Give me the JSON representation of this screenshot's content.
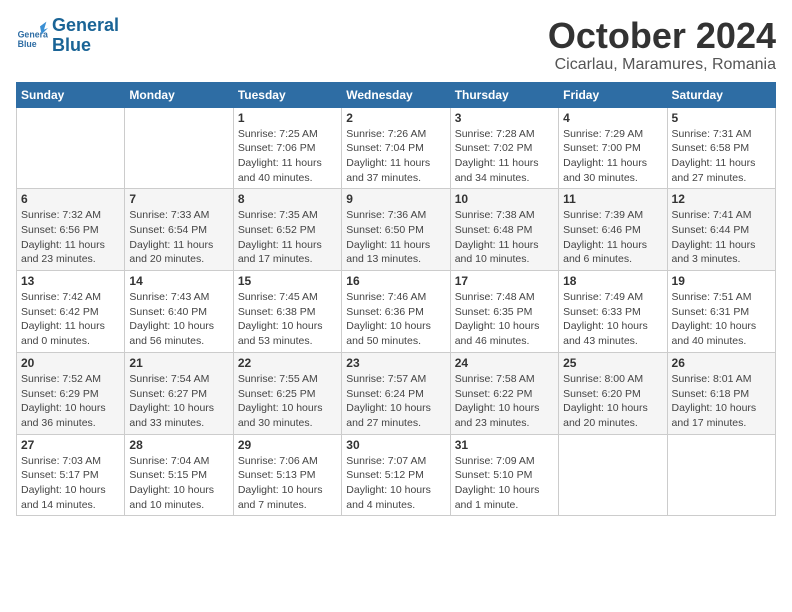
{
  "header": {
    "logo_line1": "General",
    "logo_line2": "Blue",
    "month": "October 2024",
    "location": "Cicarlau, Maramures, Romania"
  },
  "weekdays": [
    "Sunday",
    "Monday",
    "Tuesday",
    "Wednesday",
    "Thursday",
    "Friday",
    "Saturday"
  ],
  "weeks": [
    [
      {
        "day": "",
        "info": ""
      },
      {
        "day": "",
        "info": ""
      },
      {
        "day": "1",
        "info": "Sunrise: 7:25 AM\nSunset: 7:06 PM\nDaylight: 11 hours and 40 minutes."
      },
      {
        "day": "2",
        "info": "Sunrise: 7:26 AM\nSunset: 7:04 PM\nDaylight: 11 hours and 37 minutes."
      },
      {
        "day": "3",
        "info": "Sunrise: 7:28 AM\nSunset: 7:02 PM\nDaylight: 11 hours and 34 minutes."
      },
      {
        "day": "4",
        "info": "Sunrise: 7:29 AM\nSunset: 7:00 PM\nDaylight: 11 hours and 30 minutes."
      },
      {
        "day": "5",
        "info": "Sunrise: 7:31 AM\nSunset: 6:58 PM\nDaylight: 11 hours and 27 minutes."
      }
    ],
    [
      {
        "day": "6",
        "info": "Sunrise: 7:32 AM\nSunset: 6:56 PM\nDaylight: 11 hours and 23 minutes."
      },
      {
        "day": "7",
        "info": "Sunrise: 7:33 AM\nSunset: 6:54 PM\nDaylight: 11 hours and 20 minutes."
      },
      {
        "day": "8",
        "info": "Sunrise: 7:35 AM\nSunset: 6:52 PM\nDaylight: 11 hours and 17 minutes."
      },
      {
        "day": "9",
        "info": "Sunrise: 7:36 AM\nSunset: 6:50 PM\nDaylight: 11 hours and 13 minutes."
      },
      {
        "day": "10",
        "info": "Sunrise: 7:38 AM\nSunset: 6:48 PM\nDaylight: 11 hours and 10 minutes."
      },
      {
        "day": "11",
        "info": "Sunrise: 7:39 AM\nSunset: 6:46 PM\nDaylight: 11 hours and 6 minutes."
      },
      {
        "day": "12",
        "info": "Sunrise: 7:41 AM\nSunset: 6:44 PM\nDaylight: 11 hours and 3 minutes."
      }
    ],
    [
      {
        "day": "13",
        "info": "Sunrise: 7:42 AM\nSunset: 6:42 PM\nDaylight: 11 hours and 0 minutes."
      },
      {
        "day": "14",
        "info": "Sunrise: 7:43 AM\nSunset: 6:40 PM\nDaylight: 10 hours and 56 minutes."
      },
      {
        "day": "15",
        "info": "Sunrise: 7:45 AM\nSunset: 6:38 PM\nDaylight: 10 hours and 53 minutes."
      },
      {
        "day": "16",
        "info": "Sunrise: 7:46 AM\nSunset: 6:36 PM\nDaylight: 10 hours and 50 minutes."
      },
      {
        "day": "17",
        "info": "Sunrise: 7:48 AM\nSunset: 6:35 PM\nDaylight: 10 hours and 46 minutes."
      },
      {
        "day": "18",
        "info": "Sunrise: 7:49 AM\nSunset: 6:33 PM\nDaylight: 10 hours and 43 minutes."
      },
      {
        "day": "19",
        "info": "Sunrise: 7:51 AM\nSunset: 6:31 PM\nDaylight: 10 hours and 40 minutes."
      }
    ],
    [
      {
        "day": "20",
        "info": "Sunrise: 7:52 AM\nSunset: 6:29 PM\nDaylight: 10 hours and 36 minutes."
      },
      {
        "day": "21",
        "info": "Sunrise: 7:54 AM\nSunset: 6:27 PM\nDaylight: 10 hours and 33 minutes."
      },
      {
        "day": "22",
        "info": "Sunrise: 7:55 AM\nSunset: 6:25 PM\nDaylight: 10 hours and 30 minutes."
      },
      {
        "day": "23",
        "info": "Sunrise: 7:57 AM\nSunset: 6:24 PM\nDaylight: 10 hours and 27 minutes."
      },
      {
        "day": "24",
        "info": "Sunrise: 7:58 AM\nSunset: 6:22 PM\nDaylight: 10 hours and 23 minutes."
      },
      {
        "day": "25",
        "info": "Sunrise: 8:00 AM\nSunset: 6:20 PM\nDaylight: 10 hours and 20 minutes."
      },
      {
        "day": "26",
        "info": "Sunrise: 8:01 AM\nSunset: 6:18 PM\nDaylight: 10 hours and 17 minutes."
      }
    ],
    [
      {
        "day": "27",
        "info": "Sunrise: 7:03 AM\nSunset: 5:17 PM\nDaylight: 10 hours and 14 minutes."
      },
      {
        "day": "28",
        "info": "Sunrise: 7:04 AM\nSunset: 5:15 PM\nDaylight: 10 hours and 10 minutes."
      },
      {
        "day": "29",
        "info": "Sunrise: 7:06 AM\nSunset: 5:13 PM\nDaylight: 10 hours and 7 minutes."
      },
      {
        "day": "30",
        "info": "Sunrise: 7:07 AM\nSunset: 5:12 PM\nDaylight: 10 hours and 4 minutes."
      },
      {
        "day": "31",
        "info": "Sunrise: 7:09 AM\nSunset: 5:10 PM\nDaylight: 10 hours and 1 minute."
      },
      {
        "day": "",
        "info": ""
      },
      {
        "day": "",
        "info": ""
      }
    ]
  ]
}
